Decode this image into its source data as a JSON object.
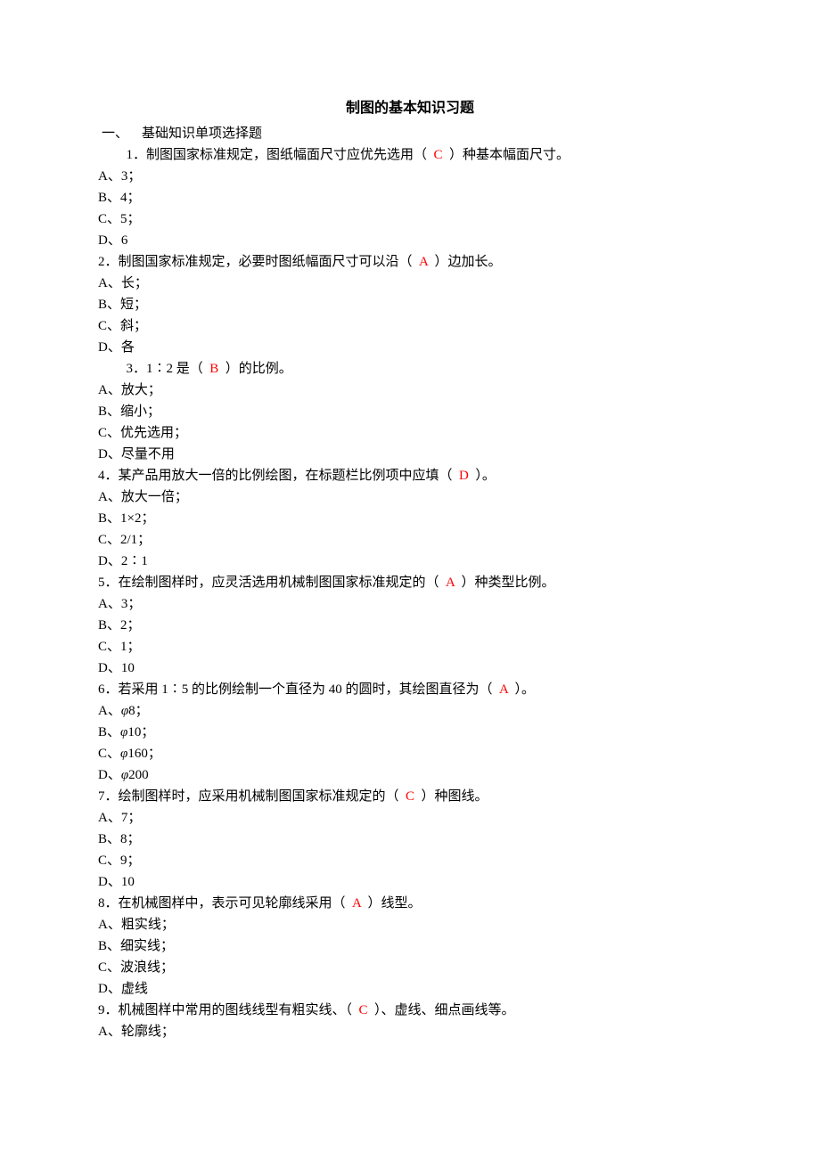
{
  "title": "制图的基本知识习题",
  "section_header": "一、    基础知识单项选择题",
  "q1": {
    "text_before": "  1．制图国家标准规定，图纸幅面尺寸应优先选用（  ",
    "answer": "C",
    "text_after": "  ）种基本幅面尺寸。",
    "opts": [
      "A、3；",
      "B、4；",
      "C、5；",
      "D、6"
    ]
  },
  "q2": {
    "text_before": "2．制图国家标准规定，必要时图纸幅面尺寸可以沿（  ",
    "answer": "A",
    "text_after": "  ）边加长。",
    "opts": [
      "A、长；",
      "B、短；",
      "C、斜；",
      "D、各"
    ]
  },
  "q3": {
    "text_before": "  3．1∶2 是（  ",
    "answer": "B",
    "text_after": "  ）的比例。",
    "opts": [
      "A、放大；",
      "B、缩小；",
      "C、优先选用；",
      "D、尽量不用"
    ]
  },
  "q4": {
    "text_before": "4．某产品用放大一倍的比例绘图，在标题栏比例项中应填（  ",
    "answer": "D",
    "text_after": "  ）。",
    "opts": [
      "A、放大一倍；",
      "B、1×2；",
      "C、2/1；",
      "D、2∶1"
    ]
  },
  "q5": {
    "text_before": "5．在绘制图样时，应灵活选用机械制图国家标准规定的（  ",
    "answer": "A",
    "text_after": "  ）种类型比例。",
    "opts": [
      "A、3；",
      "B、2；",
      "C、1；",
      "D、10"
    ]
  },
  "q6": {
    "text_before": "6．若采用 1∶5 的比例绘制一个直径为 40 的圆时，其绘图直径为（  ",
    "answer": "A",
    "text_after": "  ）。",
    "opts_phi": [
      {
        "prefix": "A、",
        "phi": "φ",
        "num": "8；"
      },
      {
        "prefix": "B、",
        "phi": "φ",
        "num": "10；"
      },
      {
        "prefix": "C、",
        "phi": "φ",
        "num": "160；"
      },
      {
        "prefix": "D、",
        "phi": "φ",
        "num": "200"
      }
    ]
  },
  "q7": {
    "text_before": "7．绘制图样时，应采用机械制图国家标准规定的（  ",
    "answer": "C",
    "text_after": "  ）种图线。",
    "opts": [
      "A、7；",
      "B、8；",
      "C、9；",
      "D、10"
    ]
  },
  "q8": {
    "text_before": "8．在机械图样中，表示可见轮廓线采用（  ",
    "answer": "A",
    "text_after": "  ）线型。",
    "opts": [
      "A、粗实线；",
      "B、细实线；",
      "C、波浪线；",
      "D、虚线"
    ]
  },
  "q9": {
    "text_before": "9．机械图样中常用的图线线型有粗实线、（  ",
    "answer": "C",
    "text_after": "  ）、虚线、细点画线等。",
    "opts": [
      "A、轮廓线；"
    ]
  }
}
